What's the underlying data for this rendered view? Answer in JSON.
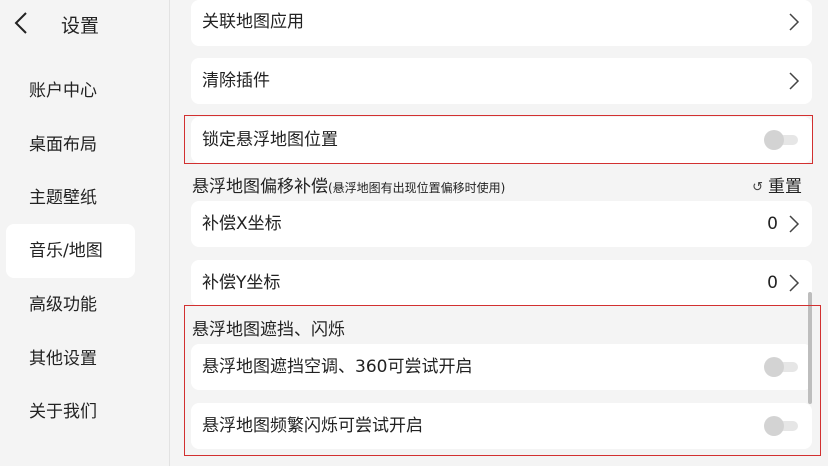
{
  "header": {
    "title": "设置"
  },
  "sidebar": {
    "items": [
      {
        "label": "账户中心"
      },
      {
        "label": "桌面布局"
      },
      {
        "label": "主题壁纸"
      },
      {
        "label": "音乐/地图"
      },
      {
        "label": "高级功能"
      },
      {
        "label": "其他设置"
      },
      {
        "label": "关于我们"
      }
    ],
    "active_index": 3
  },
  "main": {
    "rows": {
      "link_map_app": {
        "label": "关联地图应用"
      },
      "clear_plugin": {
        "label": "清除插件"
      },
      "lock_float_map": {
        "label": "锁定悬浮地图位置",
        "toggle_on": false
      }
    },
    "offset_section": {
      "title": "悬浮地图偏移补偿",
      "note": "(悬浮地图有出现位置偏移时使用)",
      "reset_label": "重置",
      "reset_icon": "↺",
      "x_label": "补偿X坐标",
      "x_value": "0",
      "y_label": "补偿Y坐标",
      "y_value": "0"
    },
    "flicker_section": {
      "title": "悬浮地图遮挡、闪烁",
      "ac_label": "悬浮地图遮挡空调、360可尝试开启",
      "ac_toggle_on": false,
      "flicker_label": "悬浮地图频繁闪烁可尝试开启",
      "flicker_toggle_on": false
    }
  },
  "colors": {
    "highlight": "#d23030",
    "card_bg": "#ffffff",
    "page_bg": "#f4f4f4",
    "toggle_off": "#d3d3d3"
  }
}
